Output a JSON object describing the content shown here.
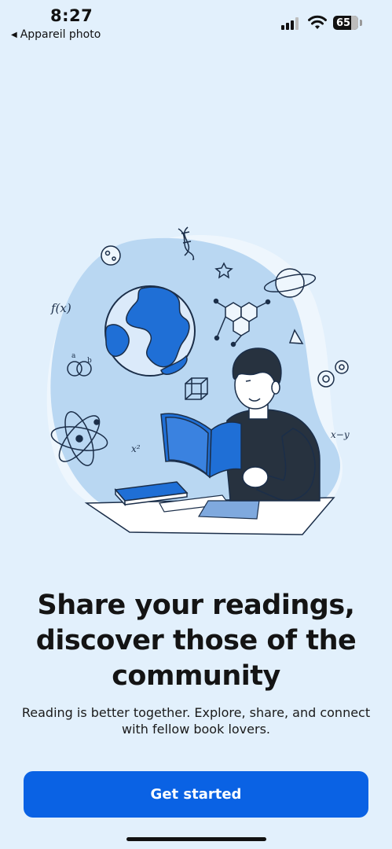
{
  "status_bar": {
    "time": "8:27",
    "back_label": "Appareil photo",
    "battery": "65",
    "icons": [
      "cellular-signal-icon",
      "wifi-icon",
      "battery-icon"
    ]
  },
  "onboarding": {
    "headline_line1": "Share your readings,",
    "headline_line2": "discover those of the",
    "headline_line3": "community",
    "subtitle_line1": "Reading is better together. Explore, share, and connect",
    "subtitle_line2": "with fellow book lovers.",
    "cta_label": "Get started"
  },
  "illustration": {
    "labels": [
      "f(x)",
      "x²",
      "x−y",
      "a",
      "b"
    ]
  },
  "colors": {
    "background": "#e2f0fc",
    "accent": "#0a62e4",
    "illustration_blue": "#1f6fd6",
    "blob": "#b9d7f2"
  }
}
